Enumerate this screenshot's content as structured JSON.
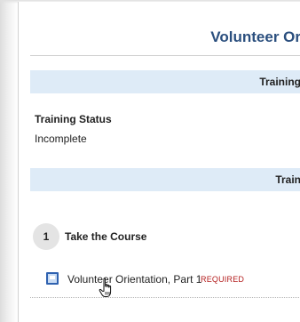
{
  "page": {
    "title": "Volunteer Or",
    "section_band_1": "Training",
    "section_band_2": "Train"
  },
  "status": {
    "label": "Training Status",
    "value": "Incomplete"
  },
  "step": {
    "number": "1",
    "title": "Take the Course"
  },
  "module": {
    "link_text": "Volunteer Orientation, Part 1",
    "required_text": "REQUIRED",
    "icon": "course-module-icon"
  },
  "cursor": {
    "icon": "hand-pointer-cursor-icon"
  },
  "colors": {
    "title": "#2b4f7e",
    "band": "#deebf7",
    "required": "#b41e1e",
    "icon_border": "#2f62b0"
  }
}
